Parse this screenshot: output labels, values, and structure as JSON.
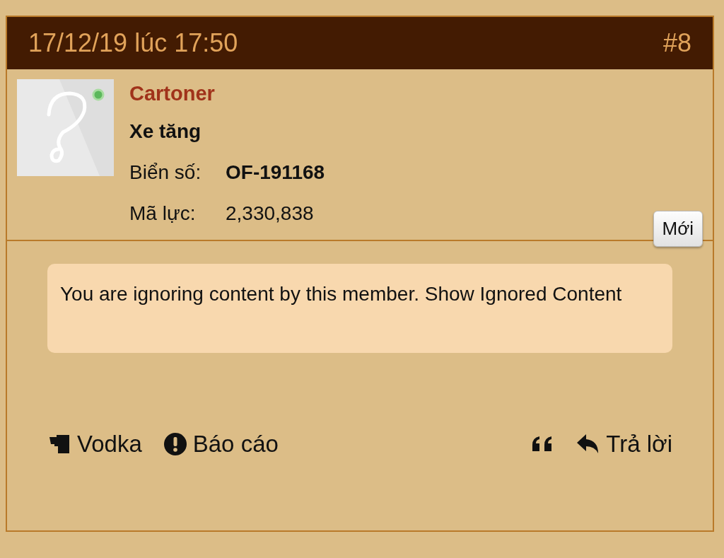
{
  "post": {
    "date": "17/12/19 lúc 17:50",
    "number": "#8"
  },
  "author": {
    "name": "Cartoner",
    "online": true,
    "rank": "Xe tăng",
    "fields": [
      {
        "label": "Biển số:",
        "value": "OF-191168",
        "bold": true
      },
      {
        "label": "Mã lực:",
        "value": "2,330,838",
        "bold": false
      }
    ]
  },
  "new_badge": "Mới",
  "notice": "You are ignoring content by this member. Show Ignored Content",
  "actions_left": [
    {
      "kind": "vodka",
      "label": "Vodka"
    },
    {
      "kind": "report",
      "label": "Báo cáo"
    }
  ],
  "actions_right": [
    {
      "kind": "quote"
    },
    {
      "kind": "reply",
      "label": "Trả lời"
    }
  ]
}
